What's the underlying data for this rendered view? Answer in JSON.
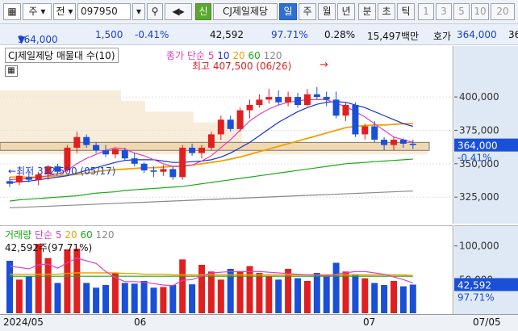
{
  "toolbar": {
    "market": "주",
    "menu_jeon": "전",
    "code": "097950",
    "sin": "신",
    "name": "CJ제일제당",
    "periods": [
      "일",
      "주",
      "월",
      "년",
      "분",
      "초",
      "틱"
    ],
    "active_period": "일",
    "minutes": [
      "1",
      "3",
      "5",
      "10",
      "20"
    ]
  },
  "quote": {
    "price": "364,000",
    "change": "1,500",
    "rate": "-0.41%",
    "volume": "42,592",
    "vol_ratio": "97.71%",
    "turnover_rate": "0.28%",
    "amount": "15,497백만",
    "ask_label": "호가",
    "ask_price": "364,000",
    "ask_extra": "36"
  },
  "price_panel": {
    "title": "CJ제일제당 매물대 수(10)",
    "ma_label": "종가 단순",
    "ma_periods": [
      "5",
      "10",
      "20",
      "60",
      "120"
    ],
    "ma_colors": [
      "#e040c0",
      "#1a2fd0",
      "#f0a000",
      "#1aaa1a",
      "#888888"
    ],
    "high_label": "최고 407,500 (06/26)",
    "low_label": "최저 332,500 (05/17)",
    "y_ticks": [
      "400,000",
      "375,000",
      "350,000",
      "325,000"
    ],
    "current_price": "364,000",
    "current_rate": "-0.41%"
  },
  "volume_panel": {
    "title": "거래량",
    "ma_label": "단순",
    "ma_periods": [
      "5",
      "20",
      "60",
      "120"
    ],
    "ma_colors": [
      "#e040c0",
      "#f0a000",
      "#1aaa1a",
      "#888888"
    ],
    "value_label": "42,592주(97.71%)",
    "y_ticks": [
      "100,000",
      "50,000"
    ],
    "current_volume": "42,592",
    "current_ratio": "97.71%"
  },
  "x_axis": {
    "labels": [
      "2024/05",
      "06",
      "07"
    ],
    "right_label": "07/05"
  },
  "chart_data": {
    "type": "candlestick",
    "y_range": [
      310000,
      420000
    ],
    "volume_range": [
      0,
      120000
    ],
    "candles": [
      {
        "o": 337000,
        "h": 340000,
        "l": 332500,
        "c": 335000,
        "v": 78000
      },
      {
        "o": 336000,
        "h": 345000,
        "l": 334000,
        "c": 341000,
        "v": 50000
      },
      {
        "o": 340000,
        "h": 344000,
        "l": 336000,
        "c": 338000,
        "v": 55000
      },
      {
        "o": 338000,
        "h": 344000,
        "l": 334000,
        "c": 342000,
        "v": 103000
      },
      {
        "o": 342000,
        "h": 349000,
        "l": 338000,
        "c": 348000,
        "v": 82000
      },
      {
        "o": 348000,
        "h": 350000,
        "l": 342000,
        "c": 344000,
        "v": 45000
      },
      {
        "o": 345000,
        "h": 364000,
        "l": 344000,
        "c": 362000,
        "v": 95000
      },
      {
        "o": 362000,
        "h": 374000,
        "l": 358000,
        "c": 370000,
        "v": 96000
      },
      {
        "o": 370000,
        "h": 372000,
        "l": 362000,
        "c": 364000,
        "v": 45000
      },
      {
        "o": 364000,
        "h": 366000,
        "l": 358000,
        "c": 360000,
        "v": 38000
      },
      {
        "o": 360000,
        "h": 364000,
        "l": 355000,
        "c": 357000,
        "v": 42000
      },
      {
        "o": 357000,
        "h": 362000,
        "l": 354000,
        "c": 361000,
        "v": 60000
      },
      {
        "o": 360000,
        "h": 362000,
        "l": 352000,
        "c": 354000,
        "v": 45000
      },
      {
        "o": 354000,
        "h": 358000,
        "l": 348000,
        "c": 350000,
        "v": 44000
      },
      {
        "o": 350000,
        "h": 351000,
        "l": 343000,
        "c": 345000,
        "v": 48000
      },
      {
        "o": 345000,
        "h": 348000,
        "l": 340000,
        "c": 344000,
        "v": 38000
      },
      {
        "o": 344000,
        "h": 349000,
        "l": 341000,
        "c": 346000,
        "v": 39000
      },
      {
        "o": 346000,
        "h": 348000,
        "l": 338000,
        "c": 340000,
        "v": 42000
      },
      {
        "o": 340000,
        "h": 364000,
        "l": 338000,
        "c": 362000,
        "v": 80000
      },
      {
        "o": 362000,
        "h": 365000,
        "l": 356000,
        "c": 358000,
        "v": 43000
      },
      {
        "o": 358000,
        "h": 364000,
        "l": 354000,
        "c": 362000,
        "v": 72000
      },
      {
        "o": 362000,
        "h": 374000,
        "l": 360000,
        "c": 372000,
        "v": 62000
      },
      {
        "o": 372000,
        "h": 386000,
        "l": 368000,
        "c": 383000,
        "v": 50000
      },
      {
        "o": 383000,
        "h": 386000,
        "l": 374000,
        "c": 376000,
        "v": 66000
      },
      {
        "o": 376000,
        "h": 392000,
        "l": 374000,
        "c": 390000,
        "v": 62000
      },
      {
        "o": 390000,
        "h": 398000,
        "l": 384000,
        "c": 394000,
        "v": 70000
      },
      {
        "o": 394000,
        "h": 402000,
        "l": 392000,
        "c": 398000,
        "v": 60000
      },
      {
        "o": 398000,
        "h": 406000,
        "l": 395000,
        "c": 400000,
        "v": 55000
      },
      {
        "o": 400000,
        "h": 405000,
        "l": 394000,
        "c": 396000,
        "v": 50000
      },
      {
        "o": 396000,
        "h": 404000,
        "l": 393000,
        "c": 400000,
        "v": 66000
      },
      {
        "o": 400000,
        "h": 403000,
        "l": 392000,
        "c": 394000,
        "v": 52000
      },
      {
        "o": 394000,
        "h": 406000,
        "l": 393000,
        "c": 402000,
        "v": 48000
      },
      {
        "o": 402000,
        "h": 407500,
        "l": 398000,
        "c": 400000,
        "v": 60000
      },
      {
        "o": 400000,
        "h": 404000,
        "l": 393000,
        "c": 398000,
        "v": 58000
      },
      {
        "o": 398000,
        "h": 404000,
        "l": 384000,
        "c": 386000,
        "v": 75000
      },
      {
        "o": 386000,
        "h": 396000,
        "l": 382000,
        "c": 394000,
        "v": 62000
      },
      {
        "o": 394000,
        "h": 396000,
        "l": 370000,
        "c": 372000,
        "v": 58000
      },
      {
        "o": 372000,
        "h": 380000,
        "l": 368000,
        "c": 378000,
        "v": 52000
      },
      {
        "o": 378000,
        "h": 382000,
        "l": 366000,
        "c": 368000,
        "v": 45000
      },
      {
        "o": 368000,
        "h": 370000,
        "l": 360000,
        "c": 364000,
        "v": 42000
      },
      {
        "o": 364000,
        "h": 370000,
        "l": 360000,
        "c": 368000,
        "v": 48000
      },
      {
        "o": 368000,
        "h": 369000,
        "l": 362000,
        "c": 365000,
        "v": 40000
      },
      {
        "o": 365000,
        "h": 368000,
        "l": 361000,
        "c": 364000,
        "v": 42592
      }
    ],
    "ma5": [
      338000,
      338500,
      339000,
      340000,
      341000,
      342500,
      345000,
      350000,
      354000,
      357000,
      360000,
      362000,
      361000,
      358000,
      356000,
      353000,
      350000,
      348000,
      348000,
      349000,
      352000,
      356000,
      362000,
      368000,
      375000,
      382000,
      387000,
      391000,
      394000,
      396000,
      397000,
      398000,
      398000,
      398000,
      395000,
      393000,
      389000,
      385000,
      380000,
      375000,
      370000,
      368000,
      366000
    ],
    "ma10": [
      336000,
      336500,
      337000,
      338000,
      339000,
      340000,
      341000,
      343000,
      345000,
      347000,
      349000,
      351000,
      352500,
      353000,
      353000,
      353000,
      352000,
      351000,
      351000,
      351500,
      352000,
      353000,
      355000,
      358000,
      362000,
      366000,
      371000,
      376000,
      381000,
      385000,
      389000,
      392000,
      394500,
      396000,
      396500,
      396000,
      394000,
      392000,
      389000,
      386000,
      383000,
      380000,
      378000
    ],
    "ma20": [
      340000,
      340000,
      340000,
      340000,
      340500,
      341000,
      341500,
      342000,
      343000,
      344000,
      345000,
      345500,
      346000,
      346500,
      347000,
      347000,
      347500,
      348000,
      348500,
      349000,
      350000,
      351000,
      352000,
      353500,
      355000,
      357000,
      359000,
      361000,
      363000,
      365000,
      367000,
      369000,
      371000,
      373000,
      375000,
      377000,
      378000,
      378500,
      379000,
      379000,
      379500,
      380000,
      380000
    ],
    "ma60": [
      322000,
      323000,
      323500,
      324000,
      324500,
      325000,
      325500,
      326000,
      327000,
      328000,
      328500,
      329000,
      330000,
      330500,
      331000,
      331500,
      332000,
      332500,
      333000,
      334000,
      335000,
      336000,
      337000,
      338000,
      339000,
      340000,
      341000,
      342000,
      343000,
      344000,
      345000,
      346000,
      347000,
      348000,
      349000,
      350000,
      350500,
      351000,
      351500,
      352000,
      352500,
      353000,
      353500
    ],
    "ma120": [
      317000,
      317300,
      317600,
      317900,
      318200,
      318500,
      318800,
      319100,
      319400,
      319700,
      320000,
      320300,
      320600,
      320900,
      321200,
      321500,
      321800,
      322100,
      322400,
      322700,
      323000,
      323300,
      323600,
      323900,
      324200,
      324500,
      324800,
      325100,
      325400,
      325700,
      326000,
      326300,
      326600,
      326900,
      327200,
      327500,
      327800,
      328100,
      328400,
      328700,
      329000,
      329300,
      329600
    ],
    "vol_ma5": [
      70000,
      68000,
      66000,
      72000,
      73000,
      67000,
      75000,
      82000,
      78000,
      74000,
      62000,
      53000,
      47000,
      47000,
      46000,
      44000,
      42000,
      41000,
      49000,
      50000,
      55000,
      60000,
      61000,
      62000,
      62000,
      62000,
      62000,
      61000,
      60000,
      59000,
      58000,
      57000,
      57000,
      55000,
      58000,
      60000,
      62000,
      62000,
      60000,
      58000,
      54000,
      50000,
      45000
    ],
    "vol_ma20": [
      58000,
      58000,
      58000,
      58000,
      58000,
      58000,
      59000,
      60000,
      60000,
      60000,
      60000,
      60000,
      59000,
      59000,
      58000,
      58000,
      58000,
      57000,
      57000,
      57000,
      57000,
      57000,
      57000,
      57000,
      57000,
      57000,
      57000,
      57000,
      57000,
      57000,
      57000,
      57000,
      57000,
      57000,
      57000,
      57000,
      57000,
      57000,
      57000,
      57000,
      57000,
      57000,
      56000
    ],
    "vol_ma60": [
      55000,
      55000,
      55000,
      55000,
      55000,
      55000,
      55000,
      55000,
      55000,
      55000,
      55000,
      55000,
      55000,
      55000,
      55000,
      55000,
      55000,
      55000,
      55000,
      55000,
      55000,
      55000,
      55000,
      55000,
      55000,
      55000,
      55000,
      55000,
      55000,
      55000,
      55000,
      55000,
      55000,
      55000,
      55000,
      55000,
      55000,
      55000,
      55000,
      55000,
      55000,
      55000,
      55000
    ]
  }
}
